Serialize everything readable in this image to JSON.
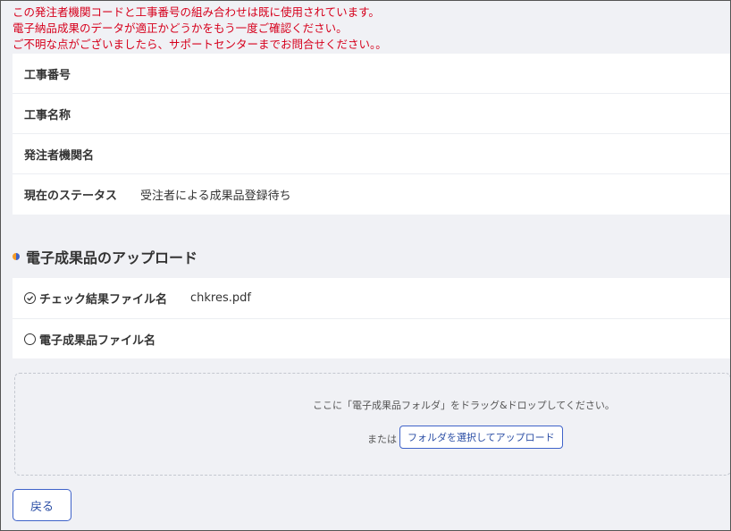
{
  "errors": [
    "この発注者機関コードと工事番号の組み合わせは既に使用されています。",
    "電子納品成果のデータが適正かどうかをもう一度ご確認ください。",
    "ご不明な点がございましたら、サポートセンターまでお問合せください。。"
  ],
  "info": {
    "rows": [
      {
        "label": "工事番号",
        "value": ""
      },
      {
        "label": "工事名称",
        "value": ""
      },
      {
        "label": "発注者機関名",
        "value": ""
      },
      {
        "label": "現在のステータス",
        "value": "受注者による成果品登録待ち"
      }
    ]
  },
  "upload": {
    "section_title": "電子成果品のアップロード",
    "files": [
      {
        "label": "チェック結果ファイル名",
        "value": "chkres.pdf",
        "icon": "check-circle-icon"
      },
      {
        "label": "電子成果品ファイル名",
        "value": "",
        "icon": "empty-circle-icon"
      }
    ],
    "drop_text": "ここに「電子成果品フォルダ」をドラッグ&ドロップしてください。",
    "or_text": "または",
    "select_button": "フォルダを選択してアップロード"
  },
  "back_button": "戻る",
  "colors": {
    "error": "#d6001c",
    "accent": "#3f63c9",
    "background": "#f0f1f5"
  }
}
